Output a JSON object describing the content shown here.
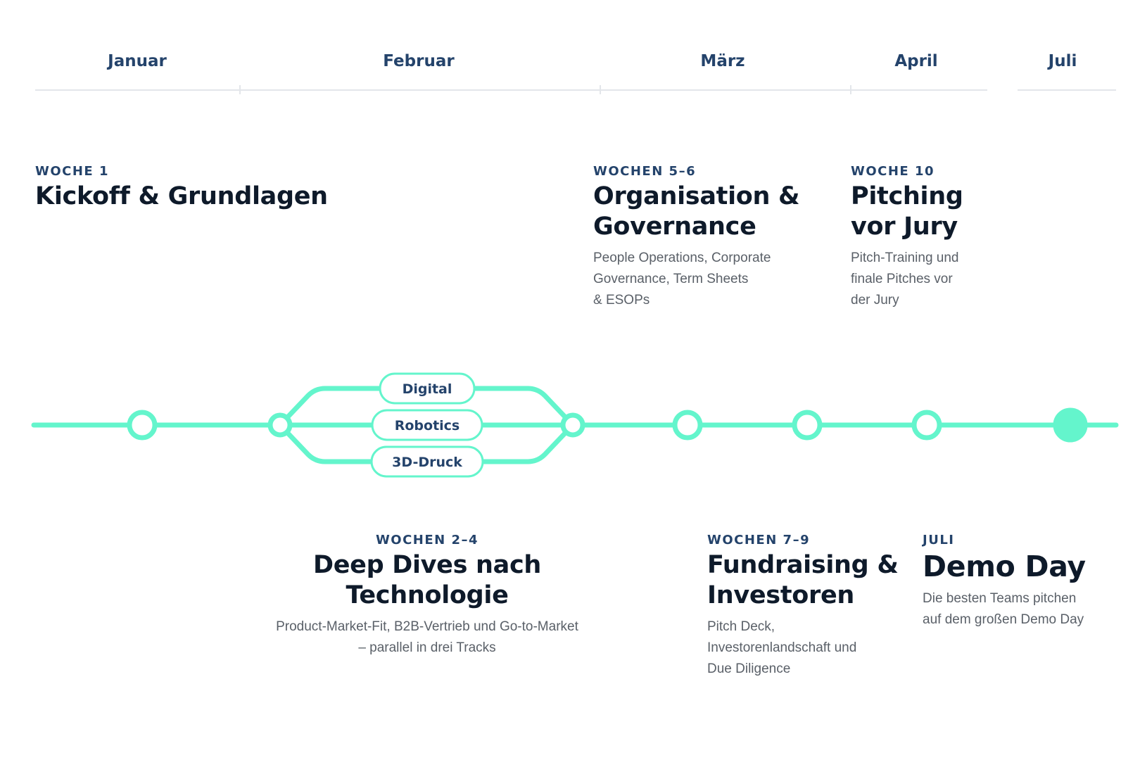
{
  "accent_color": "#64f5cc",
  "text_color": "#24436b",
  "months": [
    "Januar",
    "Februar",
    "März",
    "April",
    "Juli"
  ],
  "tracks": [
    "Digital",
    "Robotics",
    "3D-Druck"
  ],
  "phases": {
    "week1": {
      "label": "WOCHE 1",
      "title": "Kickoff & Grundlagen"
    },
    "weeks2_4": {
      "label": "WOCHEN 2–4",
      "title_line1": "Deep Dives nach",
      "title_line2": "Technologie",
      "desc_line1": "Product-Market-Fit, B2B-Vertrieb und Go-to-Market",
      "desc_line2": "– parallel in drei Tracks"
    },
    "weeks5_6": {
      "label": "WOCHEN 5–6",
      "title_line1": "Organisation &",
      "title_line2": "Governance",
      "desc_line1": "People Operations, Corporate",
      "desc_line2": "Governance, Term Sheets",
      "desc_line3": "& ESOPs"
    },
    "weeks7_9": {
      "label": "WOCHEN 7–9",
      "title_line1": "Fundraising &",
      "title_line2": "Investoren",
      "desc_line1": "Pitch Deck,",
      "desc_line2": "Investorenlandschaft und",
      "desc_line3": "Due Diligence"
    },
    "week10": {
      "label": "WOCHE 10",
      "title_line1": "Pitching",
      "title_line2": "vor Jury",
      "desc_line1": "Pitch-Training und",
      "desc_line2": "finale Pitches vor",
      "desc_line3": "der Jury"
    },
    "july": {
      "label": "JULI",
      "title": "Demo Day",
      "desc_line1": "Die besten Teams pitchen",
      "desc_line2": "auf dem großen Demo Day"
    }
  }
}
